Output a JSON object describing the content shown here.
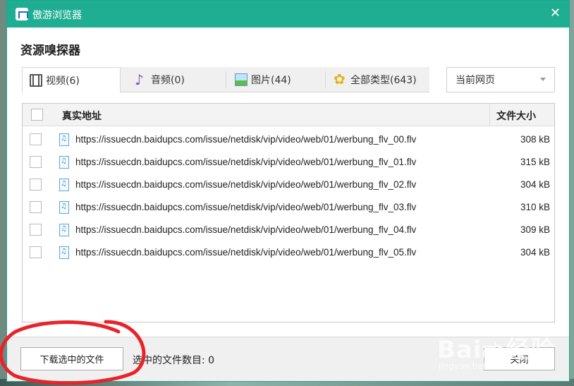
{
  "window": {
    "app_title": "傲游浏览器",
    "close_glyph": "✕"
  },
  "panel": {
    "title": "资源嗅探器"
  },
  "tabs": [
    {
      "label": "视频(6)",
      "icon": "video-icon"
    },
    {
      "label": "音频(0)",
      "icon": "audio-icon"
    },
    {
      "label": "图片(44)",
      "icon": "image-icon"
    },
    {
      "label": "全部类型(643)",
      "icon": "all-types-icon"
    }
  ],
  "scope_select": {
    "value": "当前网页"
  },
  "list": {
    "columns": {
      "url": "真实地址",
      "size": "文件大小"
    },
    "rows": [
      {
        "url": "https://issuecdn.baidupcs.com/issue/netdisk/vip/video/web/01/werbung_flv_00.flv",
        "size": "308 kB"
      },
      {
        "url": "https://issuecdn.baidupcs.com/issue/netdisk/vip/video/web/01/werbung_flv_01.flv",
        "size": "315 kB"
      },
      {
        "url": "https://issuecdn.baidupcs.com/issue/netdisk/vip/video/web/01/werbung_flv_02.flv",
        "size": "304 kB"
      },
      {
        "url": "https://issuecdn.baidupcs.com/issue/netdisk/vip/video/web/01/werbung_flv_03.flv",
        "size": "310 kB"
      },
      {
        "url": "https://issuecdn.baidupcs.com/issue/netdisk/vip/video/web/01/werbung_flv_04.flv",
        "size": "309 kB"
      },
      {
        "url": "https://issuecdn.baidupcs.com/issue/netdisk/vip/video/web/01/werbung_flv_05.flv",
        "size": "304 kB"
      }
    ]
  },
  "footer": {
    "download_label": "下载选中的文件",
    "count_label": "选中的文件数目: 0",
    "close_label": "关闭"
  },
  "watermark": {
    "main": "Baiದು经验",
    "sub": "jingyan.baidu.com"
  },
  "colors": {
    "titlebar": "#1fae91",
    "annotation": "#e8232b"
  }
}
